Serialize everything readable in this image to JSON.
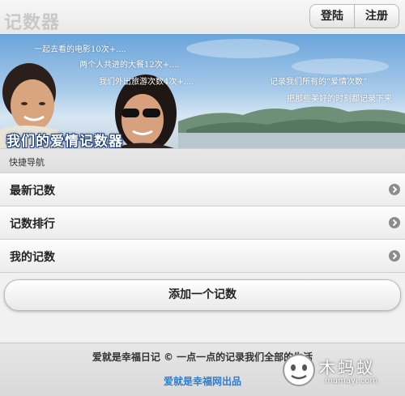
{
  "header": {
    "title": "记数器",
    "login_label": "登陆",
    "register_label": "注册"
  },
  "banner": {
    "lines": [
      "一起去看的电影10次+....",
      "两个人共进的大餐12次+....",
      "我们外出旅游次数4次+....",
      "记录我们所有的“爱情次数”",
      "把那些美好的时刻都记录下来"
    ],
    "title": "我们的爱情记数器"
  },
  "nav": {
    "section_title": "快捷导航",
    "items": [
      {
        "label": "最新记数"
      },
      {
        "label": "记数排行"
      },
      {
        "label": "我的记数"
      }
    ]
  },
  "actions": {
    "add_label": "添加一个记数"
  },
  "footer": {
    "text": "爱就是幸福日记 © 一点一点的记录我们全部的生活",
    "link": "爱就是幸福网出品"
  },
  "watermark": {
    "brand": "木蚂蚁",
    "url": "mumayi.com"
  },
  "colors": {
    "accent_link": "#2b7fd4",
    "banner_title_outline": "#1a3c78",
    "title_gray": "#c8c8c8"
  }
}
